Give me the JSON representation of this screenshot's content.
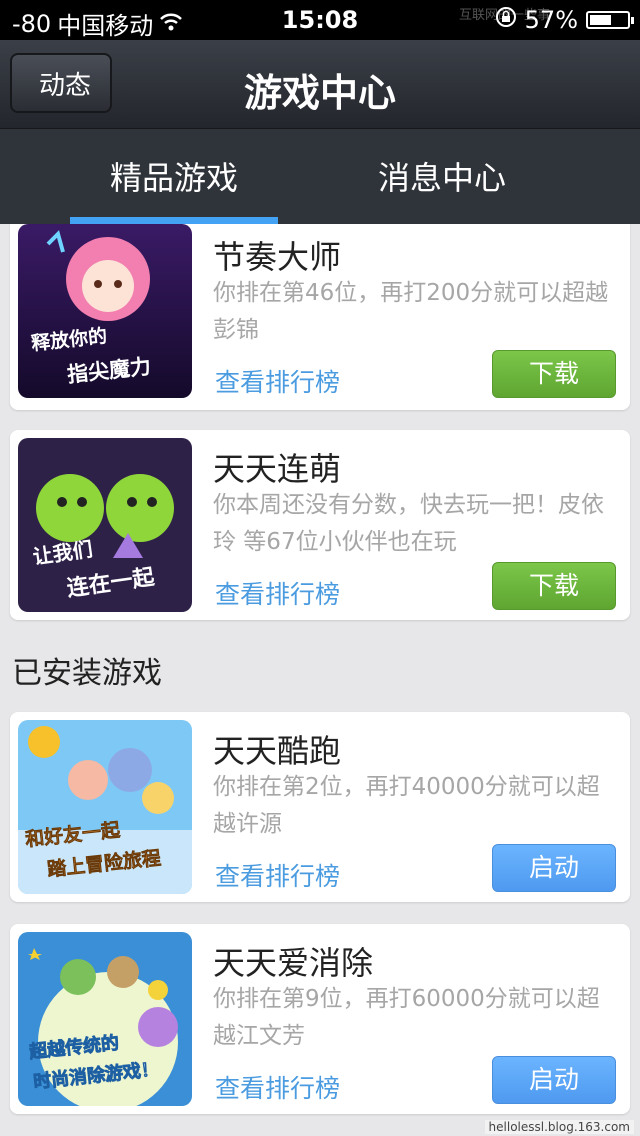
{
  "status_bar": {
    "signal": "-80",
    "carrier": "中国移动",
    "time": "15:08",
    "battery_percent": "57%",
    "battery_level": 0.57,
    "watermark": "互联网的一些事"
  },
  "nav": {
    "back_label": "动态",
    "title": "游戏中心"
  },
  "tabs": [
    {
      "label": "精品游戏",
      "active": true
    },
    {
      "label": "消息中心",
      "active": false
    }
  ],
  "featured_games": [
    {
      "name": "节奏大师",
      "description": "你排在第46位，再打200分就可以超越彭锦",
      "rank_link": "查看排行榜",
      "button": "下载",
      "thumb_text": [
        "释放你的",
        "指尖魔力"
      ]
    },
    {
      "name": "天天连萌",
      "description": "你本周还没有分数，快去玩一把！皮依玲 等67位小伙伴也在玩",
      "rank_link": "查看排行榜",
      "button": "下载",
      "thumb_text": [
        "让我们",
        "连在一起"
      ]
    }
  ],
  "installed_section_title": "已安装游戏",
  "installed_games": [
    {
      "name": "天天酷跑",
      "description": "你排在第2位，再打40000分就可以超越许源",
      "rank_link": "查看排行榜",
      "button": "启动",
      "thumb_text": [
        "和好友一起",
        "踏上冒险旅程"
      ]
    },
    {
      "name": "天天爱消除",
      "description": "你排在第9位，再打60000分就可以超越江文芳",
      "rank_link": "查看排行榜",
      "button": "启动",
      "thumb_text": [
        "超越传统的",
        "时尚消除游戏！"
      ]
    }
  ],
  "footer_watermark": "hellolessl.blog.163.com",
  "colors": {
    "tab_indicator": "#43a2f3",
    "download_button": "#6bb63d",
    "launch_button": "#5aa5f7",
    "link": "#4a9be0"
  }
}
